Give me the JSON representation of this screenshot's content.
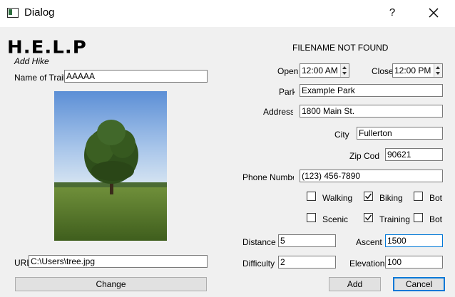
{
  "window": {
    "title": "Dialog",
    "help_label": "?"
  },
  "header": {
    "logo_text": "H.E.L.P",
    "subtitle": "Add Hike",
    "status": "FILENAME NOT FOUND"
  },
  "form": {
    "trail_name_label": "Name of Trail",
    "trail_name_value": "AAAAA",
    "url_label": "URL",
    "url_value": "C:\\Users\\tree.jpg",
    "change_button": "Change",
    "open_label": "Open",
    "open_value": "12:00 AM",
    "close_label": "Close",
    "close_value": "12:00 PM",
    "park_label": "Park",
    "park_value": "Example Park",
    "address_label": "Address",
    "address_value": "1800 Main St.",
    "city_label": "City",
    "city_value": "Fullerton",
    "zip_label": "Zip Code",
    "zip_value": "90621",
    "phone_label": "Phone Number",
    "phone_value": "(123) 456-7890",
    "checkboxes": [
      {
        "label": "Walking",
        "checked": false
      },
      {
        "label": "Biking",
        "checked": true
      },
      {
        "label": "Bot",
        "checked": false
      },
      {
        "label": "Scenic",
        "checked": false
      },
      {
        "label": "Training",
        "checked": true
      },
      {
        "label": "Bot",
        "checked": false
      }
    ],
    "distance_label": "Distance",
    "distance_value": "5",
    "ascent_label": "Ascent",
    "ascent_value": "1500",
    "difficulty_label": "Difficulty",
    "difficulty_value": "2",
    "elevation_label": "Elevation",
    "elevation_value": "100",
    "add_button": "Add",
    "cancel_button": "Cancel"
  },
  "colors": {
    "focus": "#0078d7",
    "background": "#f0f0f0",
    "titlebar": "#ffffff"
  },
  "icons": {
    "app": "window-app-icon",
    "close": "close-icon",
    "up": "spin-up-icon",
    "down": "spin-down-icon",
    "check": "checkmark-icon"
  }
}
